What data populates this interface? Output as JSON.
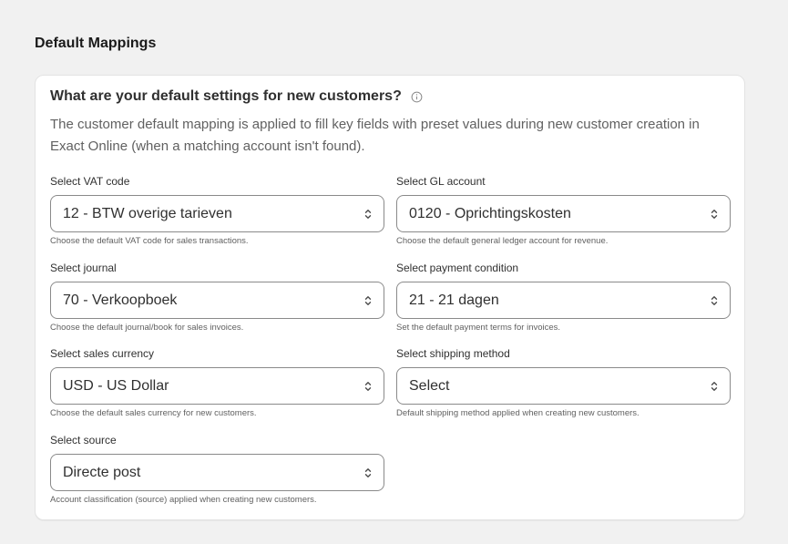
{
  "section": {
    "title": "Default Mappings"
  },
  "card": {
    "heading": "What are your default settings for new customers?",
    "info_icon": "info-circle-icon",
    "description": "The customer default mapping is applied to fill key fields with preset values during new customer creation in Exact Online (when a matching account isn't found)."
  },
  "fields": {
    "vat_code": {
      "label": "Select VAT code",
      "value": "12 - BTW overige tarieven",
      "help": "Choose the default VAT code for sales transactions."
    },
    "gl_account": {
      "label": "Select GL account",
      "value": "0120 - Oprichtingskosten",
      "help": "Choose the default general ledger account for revenue."
    },
    "journal": {
      "label": "Select journal",
      "value": "70 - Verkoopboek",
      "help": "Choose the default journal/book for sales invoices."
    },
    "payment_condition": {
      "label": "Select payment condition",
      "value": "21 - 21 dagen",
      "help": "Set the default payment terms for invoices."
    },
    "sales_currency": {
      "label": "Select sales currency",
      "value": "USD - US Dollar",
      "help": "Choose the default sales currency for new customers."
    },
    "shipping_method": {
      "label": "Select shipping method",
      "value": "Select",
      "help": "Default shipping method applied when creating new customers."
    },
    "source": {
      "label": "Select source",
      "value": "Directe post",
      "help": "Account classification (source) applied when creating new customers."
    }
  },
  "colors": {
    "page_background": "#f1f1f1",
    "card_background": "#ffffff",
    "border": "#8a8a8a",
    "text_primary": "#303030",
    "text_secondary": "#616161"
  }
}
